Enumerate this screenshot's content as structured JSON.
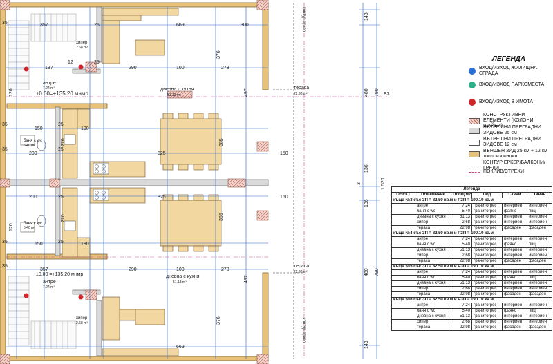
{
  "dims": {
    "d357a": "357",
    "d669a": "669",
    "d300": "300",
    "d137": "137",
    "d290a": "290",
    "d100a": "100",
    "d278a": "278",
    "d376a": "376",
    "d497a": "497",
    "d35": "35",
    "d25": "25",
    "d12": "12",
    "d150": "150",
    "d190": "190",
    "d200": "200",
    "d270": "270",
    "d825": "825",
    "d385": "385",
    "d480": "480",
    "d143": "143",
    "d136": "136",
    "d790": "790",
    "d1520": "1 520",
    "d3": "3",
    "d120": "120",
    "d63": "63",
    "d43": "43",
    "d15": "15"
  },
  "rooms": {
    "antre": "антре",
    "antre_area": "7.24 m²",
    "bath": "баня с wc",
    "bath_area": "5.40 m²",
    "living": "дневна с кухня",
    "living_area": "51.13 m²",
    "hiper": "хипер",
    "hiper_area": "2.68 m²",
    "terrace": "тераса",
    "terrace_area": "22.98 m²",
    "level_top": "±0.00=+135.20 мнмр",
    "level_bottom": "±0.00 =+135.20 мнмр",
    "contour_label": "контур еркер",
    "section": "Б3"
  },
  "legend": {
    "title": "ЛЕГЕНДА",
    "items": [
      {
        "label": "ВХОД/ИЗХОД ЖИЛИЩНА СГРАДА",
        "color": "#2a6fd6"
      },
      {
        "label": "ВХОД/ИЗХОД ПАРКОМЕСТА",
        "color": "#2bb08a"
      },
      {
        "label": "ВХОД/ИЗХОД В ИМОТА",
        "color": "#d0262b"
      },
      {
        "label": "КОНСТРУКТИВНИ ЕЛЕМЕНТИ (КОЛОНИ, ШАЙБИ)",
        "swatch": "hatch"
      },
      {
        "label": "ВЪТРЕШНИ ПРЕГРАДНИ ЗИДОВЕ 25 см",
        "swatch": "#d9d9d9"
      },
      {
        "label": "ВЪТРЕШНИ ПРЕГРАДНИ ЗИДОВЕ 12 см",
        "swatch": "#ffffff"
      },
      {
        "label": "ВЪНШЕН ЗИД 25 см + 12 см топлоизолация",
        "swatch": "#e8c27a"
      },
      {
        "label": "КОНТУР ЕРКЕР/БАЛКОНИ/ГРЕДИ",
        "line": "dashed"
      },
      {
        "label": "ПОКРИВ/СТРЕХИ",
        "line": "dashdot"
      }
    ]
  },
  "table": {
    "title": "Легенда",
    "headers": [
      "ОБЕКТ",
      "Помещение",
      "Площ м2",
      "Под",
      "Стени",
      "Таван"
    ],
    "groups": [
      {
        "name": "къща №3 със ЗП = 82.50 кв.м и РЗП = 190.10 кв.м",
        "rows": [
          [
            "антре",
            "7.24",
            "гранитогрес",
            "интериен",
            "интериен"
          ],
          [
            "баня с wc",
            "5.40",
            "гранитогрес",
            "фаянс",
            "пвц"
          ],
          [
            "дневна с кухня",
            "51.13",
            "гранитогрес",
            "интериен",
            "интериен"
          ],
          [
            "хипер",
            "2.68",
            "гранитогрес",
            "интериен",
            "интериен"
          ],
          [
            "тераса",
            "22.98",
            "гранитогрес",
            "фасаден",
            "фасаден"
          ]
        ]
      },
      {
        "name": "къща №4 със ЗП = 82.50 кв.м и РЗП = 190.10 кв.м",
        "rows": [
          [
            "антре",
            "7.24",
            "гранитогрес",
            "интериен",
            "интериен"
          ],
          [
            "баня с wc",
            "5.40",
            "гранитогрес",
            "фаянс",
            "пвц"
          ],
          [
            "дневна с кухня",
            "51.13",
            "гранитогрес",
            "интериен",
            "интериен"
          ],
          [
            "хипер",
            "2.68",
            "гранитогрес",
            "интериен",
            "интериен"
          ],
          [
            "тераса",
            "22.98",
            "гранитогрес",
            "фасаден",
            "фасаден"
          ]
        ]
      },
      {
        "name": "къща №5 със ЗП = 82.50 кв.м и РЗП = 190.10 кв.м",
        "rows": [
          [
            "антре",
            "7.24",
            "гранитогрес",
            "интериен",
            "интериен"
          ],
          [
            "баня с wc",
            "5.40",
            "гранитогрес",
            "фаянс",
            "пвц"
          ],
          [
            "дневна с кухня",
            "51.13",
            "гранитогрес",
            "интериен",
            "интериен"
          ],
          [
            "хипер",
            "2.68",
            "гранитогрес",
            "интериен",
            "интериен"
          ],
          [
            "тераса",
            "22.98",
            "гранитогрес",
            "фасаден",
            "фасаден"
          ]
        ]
      },
      {
        "name": "къща №6 със ЗП = 82.50 кв.м и РЗП = 190.10 кв.м",
        "rows": [
          [
            "антре",
            "7.24",
            "гранитогрес",
            "интериен",
            "интериен"
          ],
          [
            "баня с wc",
            "5.40",
            "гранитогрес",
            "фаянс",
            "пвц"
          ],
          [
            "дневна с кухня",
            "51.13",
            "гранитогрес",
            "интериен",
            "интериен"
          ],
          [
            "хипер",
            "2.68",
            "гранитогрес",
            "интериен",
            "интериен"
          ],
          [
            "тераса",
            "22.98",
            "гранитогрес",
            "фасаден",
            "фасаден"
          ]
        ]
      }
    ]
  }
}
